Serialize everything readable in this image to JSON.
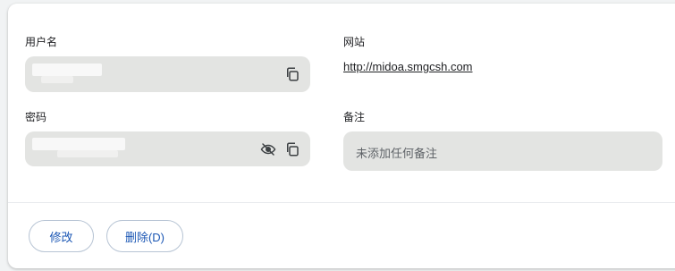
{
  "username": {
    "label": "用户名"
  },
  "password": {
    "label": "密码"
  },
  "website": {
    "label": "网站",
    "url": "http://midoa.smgcsh.com"
  },
  "note": {
    "label": "备注",
    "placeholder": "未添加任何备注"
  },
  "actions": {
    "edit_label": "修改",
    "delete_label": "删除(D)"
  },
  "icons": {
    "copy": "copy-icon",
    "visibility_toggle": "eye-off-icon"
  }
}
